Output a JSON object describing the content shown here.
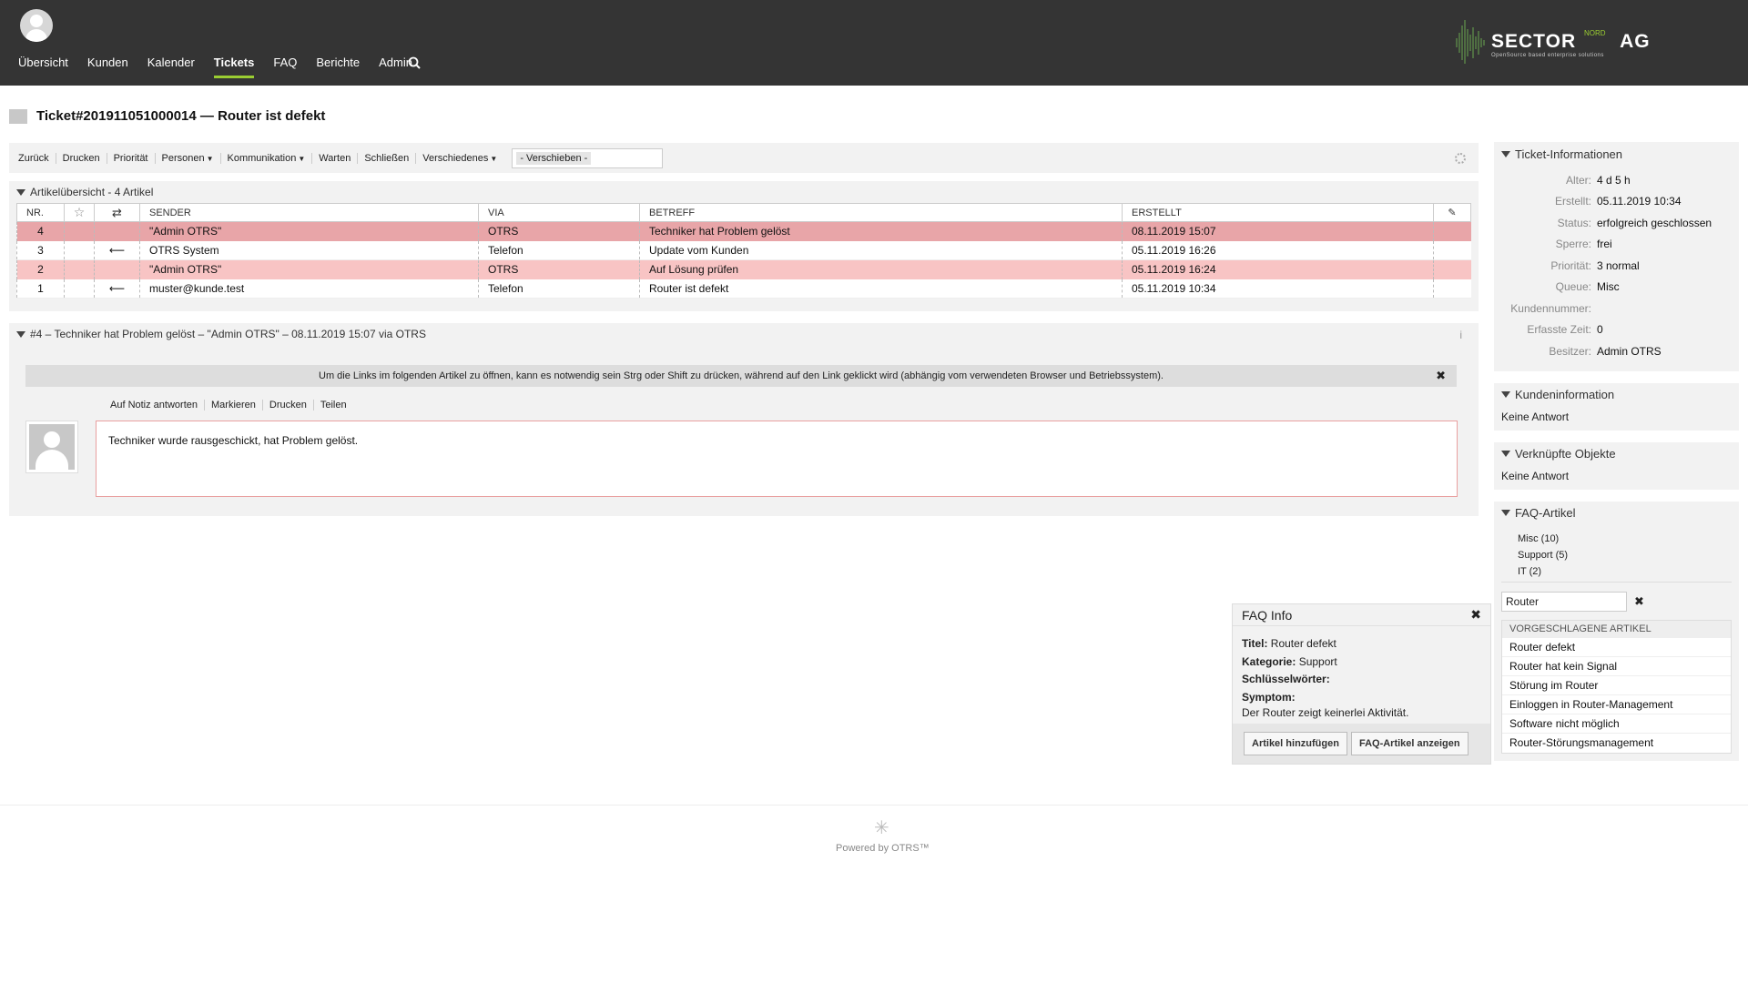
{
  "nav": {
    "items": [
      "Übersicht",
      "Kunden",
      "Kalender",
      "Tickets",
      "FAQ",
      "Berichte",
      "Admin"
    ],
    "active": "Tickets"
  },
  "logo": {
    "main": "SECTOR",
    "sup": "NORD",
    "suffix": "AG",
    "sub": "OpenSource based enterprise solutions"
  },
  "ticket": {
    "title": "Ticket#201911051000014 — Router ist defekt"
  },
  "actions": {
    "back": "Zurück",
    "print": "Drucken",
    "priority": "Priorität",
    "people": "Personen",
    "communication": "Kommunikation",
    "pending": "Warten",
    "close": "Schließen",
    "misc": "Verschiedenes",
    "move_placeholder": "- Verschieben -"
  },
  "article_overview": {
    "title": "Artikelübersicht - 4 Artikel",
    "columns": [
      "NR.",
      "",
      "",
      "SENDER",
      "VIA",
      "BETREFF",
      "ERSTELLT",
      ""
    ],
    "rows": [
      {
        "nr": "4",
        "dir": "",
        "sender": "\"Admin OTRS\"",
        "via": "OTRS",
        "subject": "Techniker hat Problem gelöst",
        "created": "08.11.2019 15:07"
      },
      {
        "nr": "3",
        "dir": "⟵",
        "sender": "OTRS System",
        "via": "Telefon",
        "subject": "Update vom Kunden",
        "created": "05.11.2019 16:26"
      },
      {
        "nr": "2",
        "dir": "",
        "sender": "\"Admin OTRS\"",
        "via": "OTRS",
        "subject": "Auf Lösung prüfen",
        "created": "05.11.2019 16:24"
      },
      {
        "nr": "1",
        "dir": "⟵",
        "sender": "muster@kunde.test",
        "via": "Telefon",
        "subject": "Router ist defekt",
        "created": "05.11.2019 10:34"
      }
    ]
  },
  "article": {
    "header": "#4 – Techniker hat Problem gelöst – \"Admin OTRS\" – 08.11.2019 15:07 via OTRS",
    "notice": "Um die Links im folgenden Artikel zu öffnen, kann es notwendig sein Strg oder Shift zu drücken, während auf den Link geklickt wird (abhängig vom verwendeten Browser und Betriebssystem).",
    "actions": [
      "Auf Notiz antworten",
      "Markieren",
      "Drucken",
      "Teilen"
    ],
    "body": "Techniker wurde rausgeschickt, hat Problem gelöst."
  },
  "ticket_info": {
    "title": "Ticket-Informationen",
    "fields": [
      {
        "k": "Alter:",
        "v": "4 d 5 h"
      },
      {
        "k": "Erstellt:",
        "v": "05.11.2019 10:34"
      },
      {
        "k": "Status:",
        "v": "erfolgreich geschlossen"
      },
      {
        "k": "Sperre:",
        "v": "frei"
      },
      {
        "k": "Priorität:",
        "v": "3 normal"
      },
      {
        "k": "Queue:",
        "v": "Misc"
      },
      {
        "k": "Kundennummer:",
        "v": ""
      },
      {
        "k": "Erfasste Zeit:",
        "v": "0"
      },
      {
        "k": "Besitzer:",
        "v": "Admin OTRS"
      }
    ]
  },
  "customer_info": {
    "title": "Kundeninformation",
    "value": "Keine Antwort"
  },
  "linked_objects": {
    "title": "Verknüpfte Objekte",
    "value": "Keine Antwort"
  },
  "faq": {
    "title": "FAQ-Artikel",
    "categories": [
      "Misc (10)",
      "Support (5)",
      "IT (2)"
    ],
    "search_value": "Router",
    "suggest_title": "VORGESCHLAGENE ARTIKEL",
    "suggestions": [
      "Router defekt",
      "Router hat kein Signal",
      "Störung im Router",
      "Einloggen in Router-Management",
      "Software nicht möglich",
      "Router-Störungsmanagement"
    ]
  },
  "faq_popup": {
    "title": "FAQ Info",
    "titel_label": "Titel:",
    "titel_value": "Router defekt",
    "kategorie_label": "Kategorie:",
    "kategorie_value": "Support",
    "keywords_label": "Schlüsselwörter:",
    "symptom_label": "Symptom:",
    "symptom_value": "Der Router zeigt keinerlei Aktivität.",
    "btn_add": "Artikel hinzufügen",
    "btn_show": "FAQ-Artikel anzeigen"
  },
  "footer": {
    "text": "Powered by OTRS™"
  },
  "colors": {
    "header_bg": "#343434",
    "accent": "#9acd32",
    "row_highlight": "#e8a5a8",
    "row_light": "#f8c4c4"
  }
}
